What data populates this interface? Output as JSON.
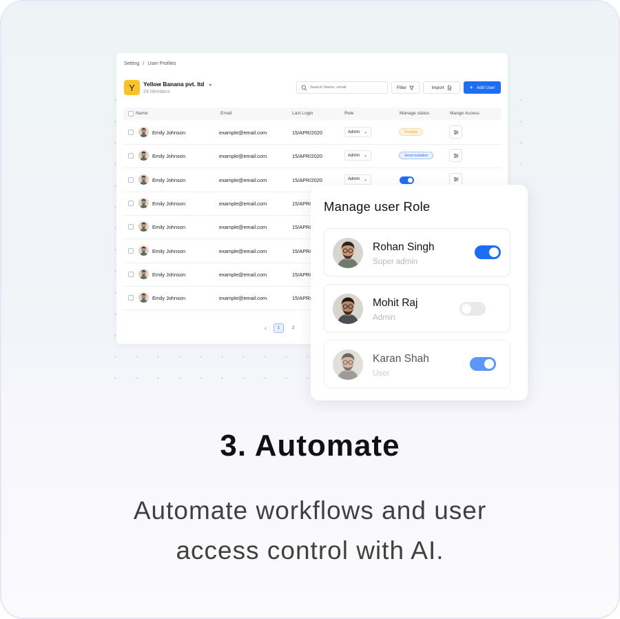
{
  "breadcrumb": [
    "Setting",
    "/",
    "User Profiles"
  ],
  "company": {
    "logo_letter": "Y",
    "name": "Yellow Banana pvt. ltd",
    "members": "24 Members"
  },
  "toolbar": {
    "search_placeholder": "Search Name, email",
    "filter_label": "Filter",
    "import_label": "Import",
    "add_label": "Add User"
  },
  "table": {
    "headers": {
      "name": "Name",
      "email": "Email",
      "last_login": "Last Login",
      "role": "Role",
      "status": "Manage status",
      "access": "Mange Access"
    },
    "rows": [
      {
        "name": "Emily Johnson",
        "email": "example@email.com",
        "last_login": "15/APR/2020",
        "role": "Admin",
        "status": "Pending"
      },
      {
        "name": "Emily Johnson",
        "email": "example@email.com",
        "last_login": "15/APR/2020",
        "role": "Admin",
        "status": "Send invitation"
      },
      {
        "name": "Emily Johnson",
        "email": "example@email.com",
        "last_login": "15/APR/2020",
        "role": "Admin",
        "status": "toggle-on"
      },
      {
        "name": "Emily Johnson",
        "email": "example@email.com",
        "last_login": "15/APR/"
      },
      {
        "name": "Emily Johnson",
        "email": "example@email.com",
        "last_login": "15/APR/"
      },
      {
        "name": "Emily Johnson",
        "email": "example@email.com",
        "last_login": "15/APR/"
      },
      {
        "name": "Emily Johnson",
        "email": "example@email.com",
        "last_login": "15/APR/"
      },
      {
        "name": "Emily Johnson",
        "email": "example@email.com",
        "last_login": "15/APR/"
      }
    ]
  },
  "pagination": {
    "pages": [
      "1",
      "2"
    ],
    "active": "1"
  },
  "panel": {
    "title": "Manage user Role",
    "users": [
      {
        "name": "Rohan Singh",
        "role": "Super admin",
        "enabled": true
      },
      {
        "name": "Mohit Raj",
        "role": "Admin",
        "enabled": false
      },
      {
        "name": "Karan Shah",
        "role": "User",
        "enabled": true
      }
    ]
  },
  "headline": "3. Automate",
  "subtitle": [
    "Automate workflows and user",
    "access control with AI."
  ],
  "colors": {
    "accent": "#1e6ef5",
    "logo": "#fbc12a",
    "pending": "#e0a431"
  }
}
